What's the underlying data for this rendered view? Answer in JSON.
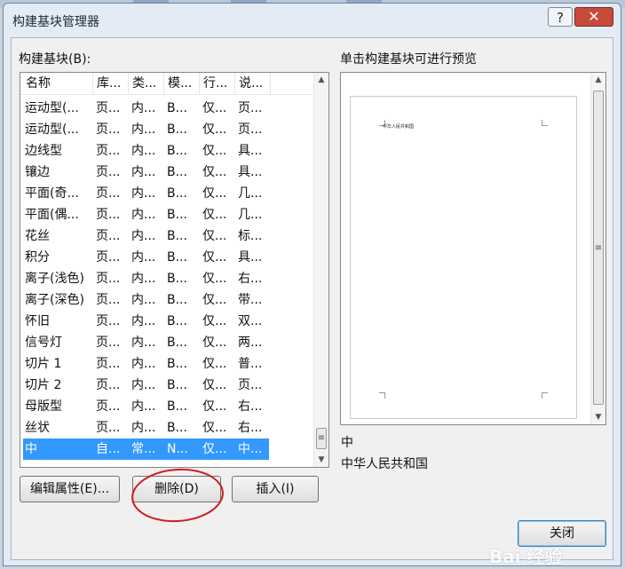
{
  "dialog": {
    "title": "构建基块管理器",
    "help_glyph": "?",
    "close_glyph": "✕"
  },
  "list": {
    "label": "构建基块(B):",
    "columns": [
      "名称",
      "库...",
      "类...",
      "模...",
      "行...",
      "说..."
    ],
    "rows": [
      [
        "运动型(...",
        "页...",
        "内...",
        "B...",
        "仅...",
        "页..."
      ],
      [
        "运动型(...",
        "页...",
        "内...",
        "B...",
        "仅...",
        "页..."
      ],
      [
        "边线型",
        "页...",
        "内...",
        "B...",
        "仅...",
        "具..."
      ],
      [
        "镶边",
        "页...",
        "内...",
        "B...",
        "仅...",
        "具..."
      ],
      [
        "平面(奇...",
        "页...",
        "内...",
        "B...",
        "仅...",
        "几..."
      ],
      [
        "平面(偶...",
        "页...",
        "内...",
        "B...",
        "仅...",
        "几..."
      ],
      [
        "花丝",
        "页...",
        "内...",
        "B...",
        "仅...",
        "标..."
      ],
      [
        "积分",
        "页...",
        "内...",
        "B...",
        "仅...",
        "具..."
      ],
      [
        "离子(浅色)",
        "页...",
        "内...",
        "B...",
        "仅...",
        "右..."
      ],
      [
        "离子(深色)",
        "页...",
        "内...",
        "B...",
        "仅...",
        "带..."
      ],
      [
        "怀旧",
        "页...",
        "内...",
        "B...",
        "仅...",
        "双..."
      ],
      [
        "信号灯",
        "页...",
        "内...",
        "B...",
        "仅...",
        "两..."
      ],
      [
        "切片 1",
        "页...",
        "内...",
        "B...",
        "仅...",
        "普..."
      ],
      [
        "切片 2",
        "页...",
        "内...",
        "B...",
        "仅...",
        "页..."
      ],
      [
        "母版型",
        "页...",
        "内...",
        "B...",
        "仅...",
        "右..."
      ],
      [
        "丝状",
        "页...",
        "内...",
        "B...",
        "仅...",
        "右..."
      ],
      [
        "中",
        "自...",
        "常...",
        "N...",
        "仅...",
        "中..."
      ]
    ],
    "selected_index": 16
  },
  "preview": {
    "label": "单击构建基块可进行预览",
    "page_text": "中华人民共和国"
  },
  "details": {
    "name": "中",
    "description": "中华人民共和国"
  },
  "buttons": {
    "edit": "编辑属性(E)...",
    "delete": "删除(D)",
    "insert": "插入(I)",
    "close": "关闭"
  },
  "watermark": "Bai 经验",
  "colors": {
    "selection": "#3399ff",
    "annotation": "#d11a1a"
  }
}
